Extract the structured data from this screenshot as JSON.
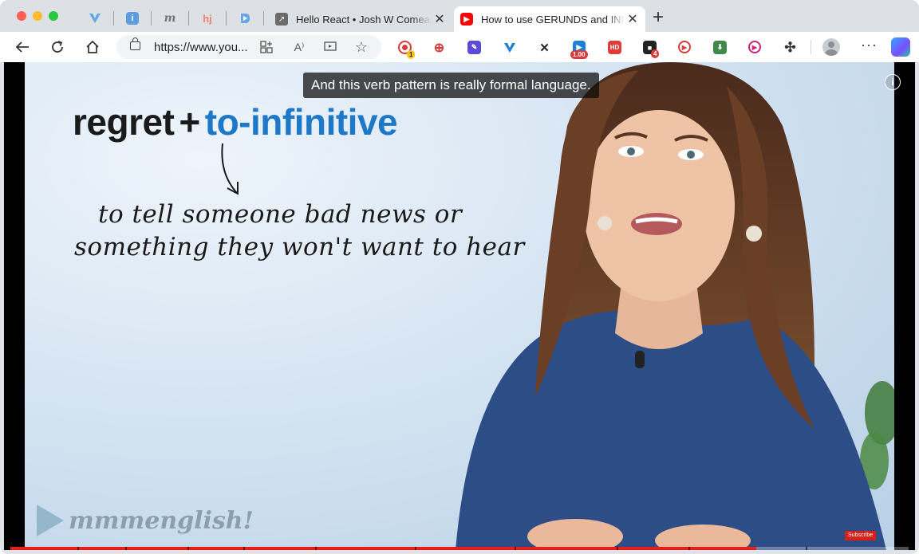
{
  "tabs": {
    "inactive_title": "Hello React • Josh W Comeau",
    "active_title": "How to use GERUNDS and INFINITIVES"
  },
  "toolbar": {
    "url": "https://www.you..."
  },
  "extensions": {
    "badge_1": "1",
    "speed_badge": "1.00",
    "hd_label": "HD",
    "badge_4": "4"
  },
  "video": {
    "caption": "And this verb pattern is really formal language.",
    "info_label": "i",
    "headline": {
      "word": "regret",
      "plus": "+",
      "form": "to-infinitive"
    },
    "note_line1": "to tell someone bad news or",
    "note_line2": "something they won't want to hear",
    "logo_text": "mmmenglish!",
    "subscribe_label": "Subscribe",
    "progress": 0.83
  },
  "colors": {
    "progress_red": "#e5201b",
    "youtube_red": "#ff0000",
    "headline_blue": "#1e78c8"
  }
}
